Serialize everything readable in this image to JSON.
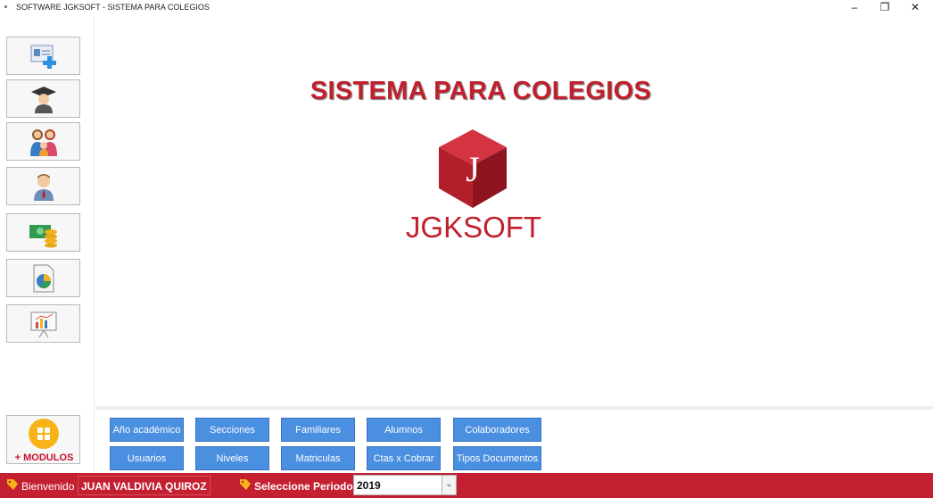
{
  "window": {
    "title": "SOFTWARE JGKSOFT - SISTEMA PARA COLEGIOS",
    "controls": {
      "minimize": "–",
      "restore": "❐",
      "close": "✕"
    }
  },
  "sidebar": {
    "buttons": [
      {
        "icon": "id-card-add-icon"
      },
      {
        "icon": "graduate-icon"
      },
      {
        "icon": "family-icon"
      },
      {
        "icon": "employee-icon"
      },
      {
        "icon": "money-coins-icon"
      },
      {
        "icon": "pie-chart-report-icon"
      },
      {
        "icon": "presentation-chart-icon"
      }
    ],
    "modules_label": "+ MODULOS"
  },
  "main": {
    "title": "SISTEMA PARA COLEGIOS",
    "logo_letter": "J",
    "logo_text": "JGKSOFT"
  },
  "modules": {
    "row1": [
      "Año académico",
      "Secciones",
      "Familiares",
      "Alumnos",
      "Colaboradores"
    ],
    "row2": [
      "Usuarios",
      "Niveles",
      "Matriculas",
      "Ctas x Cobrar",
      "Tipos Documentos"
    ]
  },
  "status": {
    "welcome_label": "Bienvenido",
    "user": "JUAN VALDIVIA QUIROZ",
    "period_label": "Seleccione Periodo :",
    "period_value": "2019"
  },
  "colors": {
    "brand_red": "#c0202e",
    "status_red": "#c51f32",
    "module_blue": "#4a8fe0",
    "modules_yellow": "#f6b418"
  }
}
